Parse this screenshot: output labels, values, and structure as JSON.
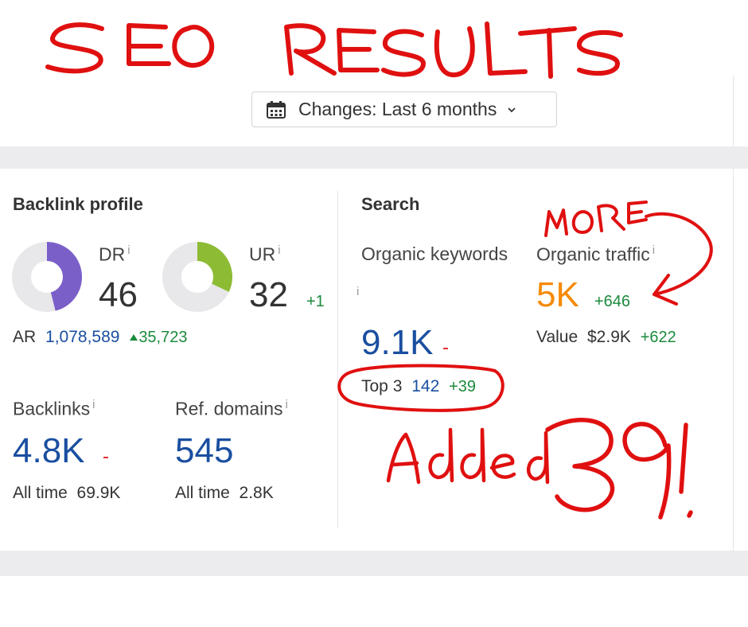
{
  "annotations": {
    "title": "SEO RESULTS",
    "more": "MORE",
    "added": "Added 39!"
  },
  "filter": {
    "label": "Changes: Last 6 months"
  },
  "backlink_profile": {
    "title": "Backlink profile",
    "dr": {
      "label": "DR",
      "info": "i",
      "value": "46",
      "fill": 0.46,
      "color": "#7b5fc9"
    },
    "ur": {
      "label": "UR",
      "info": "i",
      "value": "32",
      "delta": "+1",
      "fill": 0.32,
      "color": "#8dbc34"
    },
    "ar": {
      "label": "AR",
      "value": "1,078,589",
      "delta": "35,723"
    },
    "backlinks": {
      "label": "Backlinks",
      "info": "i",
      "value": "4.8K",
      "all_time_label": "All time",
      "all_time_value": "69.9K"
    },
    "ref_domains": {
      "label": "Ref. domains",
      "info": "i",
      "value": "545",
      "all_time_label": "All time",
      "all_time_value": "2.8K"
    }
  },
  "search": {
    "title": "Search",
    "organic_keywords": {
      "label": "Organic keywords",
      "info": "i",
      "value": "9.1K",
      "top3_label": "Top 3",
      "top3_value": "142",
      "top3_delta": "+39"
    },
    "organic_traffic": {
      "label": "Organic traffic",
      "info": "i",
      "value": "5K",
      "delta": "+646",
      "value_label": "Value",
      "value_amount": "$2.9K",
      "value_delta": "+622"
    }
  },
  "colors": {
    "blue": "#1a4fa0",
    "green": "#1c8a3c",
    "orange": "#f58a07",
    "annotation_red": "#e01010"
  }
}
